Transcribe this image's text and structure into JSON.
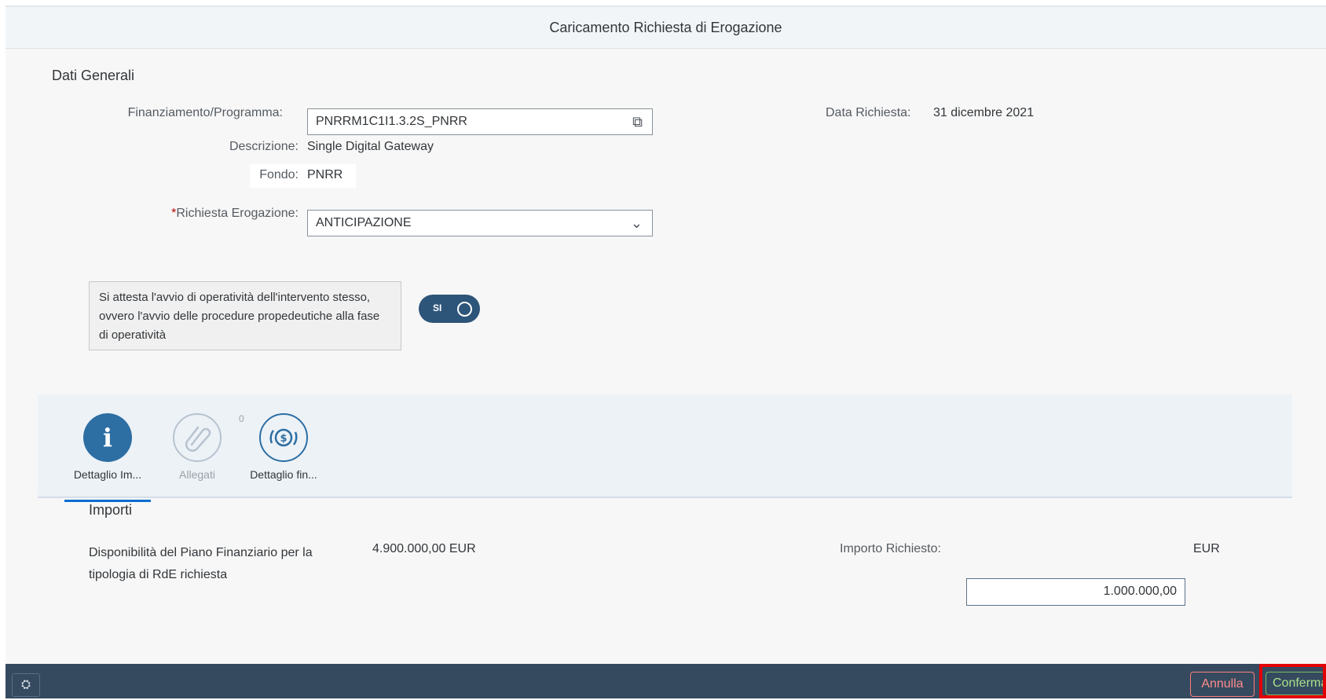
{
  "dialog": {
    "title": "Caricamento Richiesta di Erogazione"
  },
  "general": {
    "section_title": "Dati Generali",
    "finanziamento_label": "Finanziamento/Programma:",
    "finanziamento_value": "PNRRM1C1I1.3.2S_PNRR",
    "descrizione_label": "Descrizione:",
    "descrizione_value": "Single Digital Gateway",
    "fondo_label": "Fondo:",
    "fondo_value": "PNRR",
    "richiesta_required_mark": "*",
    "richiesta_label": "Richiesta Erogazione:",
    "richiesta_value": "ANTICIPAZIONE",
    "data_richiesta_label": "Data Richiesta:",
    "data_richiesta_value": "31 dicembre 2021",
    "attestation_text": "Si attesta l'avvio di operatività dell'intervento stesso, ovvero l'avvio delle procedure propedeutiche alla fase di operatività",
    "switch_text": "SI"
  },
  "tabs": [
    {
      "label": "Dettaglio Im...",
      "icon": "info-icon",
      "selected": true
    },
    {
      "label": "Allegati",
      "icon": "paperclip-icon",
      "selected": false,
      "badge": "0"
    },
    {
      "label": "Dettaglio fin...",
      "icon": "money-icon",
      "selected": false
    }
  ],
  "importi": {
    "section_title": "Importi",
    "disponibilita_label": "Disponibilità del Piano Finanziario per la tipologia di RdE richiesta",
    "disponibilita_value": "4.900.000,00 EUR",
    "importo_label": "Importo Richiesto:",
    "importo_value": "1.000.000,00",
    "importo_currency": "EUR"
  },
  "footer": {
    "annulla_label": "Annulla",
    "conferma_label": "Conferma"
  },
  "colors": {
    "accent": "#0a6ed1",
    "footer_bg": "#354a5f",
    "switch_bg": "#2d5479",
    "highlight_red": "#e30000"
  }
}
